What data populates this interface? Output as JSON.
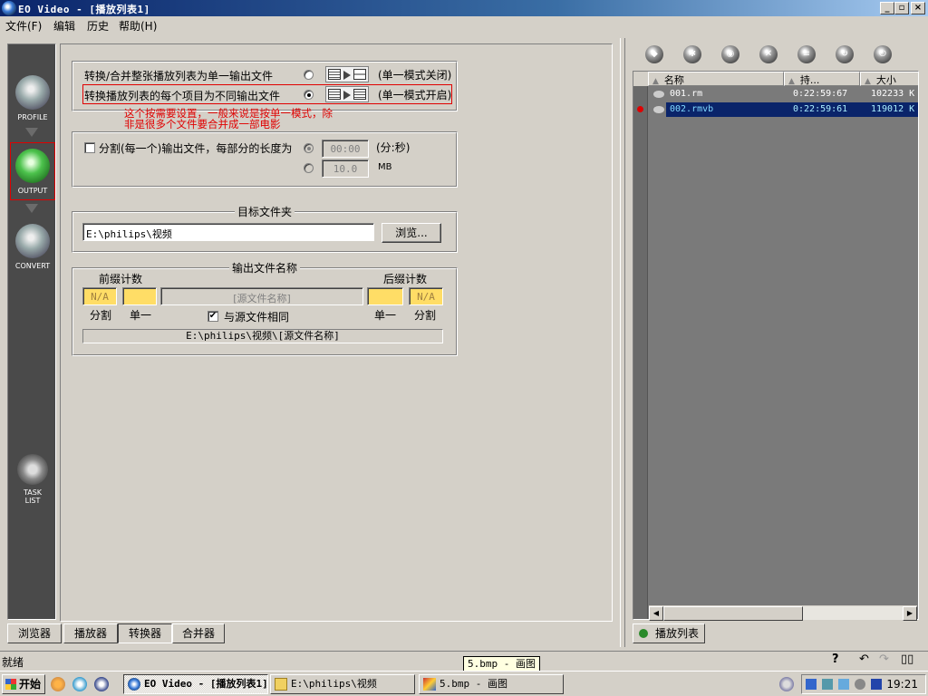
{
  "window": {
    "title": "EO Video - [播放列表1]",
    "min": "_",
    "max": "▫",
    "close": "×"
  },
  "menu": [
    "文件(F)",
    "编辑",
    "历史",
    "帮助(H)"
  ],
  "nav": {
    "profile": "PROFILE",
    "output": "OUTPUT",
    "convert": "CONVERT",
    "task_list": "TASK LIST"
  },
  "mode": {
    "single_label": "转换/合并整张播放列表为单一输出文件",
    "single_mode": "(单一模式关闭)",
    "multi_label": "转换播放列表的每个项目为不同输出文件",
    "multi_mode": "(单一模式开启)",
    "selected": "multi"
  },
  "note": {
    "line1": "这个按需要设置，一般来说是按单一模式，除",
    "line2": "非是很多个文件要合并成一部电影"
  },
  "split": {
    "label": "分割(每一个)输出文件，每部分的长度为",
    "checked": false,
    "time_value": "00:00",
    "time_unit": "(分:秒)",
    "size_value": "10.0",
    "size_unit": "MB"
  },
  "target": {
    "legend": "目标文件夹",
    "path": "E:\\philips\\视频",
    "browse": "浏览..."
  },
  "outname": {
    "legend": "输出文件名称",
    "prefix_label": "前缀计数",
    "suffix_label": "后缀计数",
    "na1": "N/A",
    "na2": "N/A",
    "source_name": "[源文件名称]",
    "split": "分割",
    "single": "单一",
    "single2": "单一",
    "split2": "分割",
    "same_as_source": "与源文件相同",
    "same_checked": true,
    "preview": "E:\\philips\\视频\\[源文件名称]"
  },
  "tabs": [
    "浏览器",
    "播放器",
    "转换器",
    "合并器"
  ],
  "playlist": {
    "columns": [
      "名称",
      "持...",
      "大小"
    ],
    "rows": [
      {
        "name": "001.rm",
        "duration": "0:22:59:67",
        "size": "102233 K"
      },
      {
        "name": "002.rmvb",
        "duration": "0:22:59:61",
        "size": "119012 K"
      }
    ],
    "selected_row": 1,
    "tab": "播放列表"
  },
  "status": {
    "text": "就绪",
    "tooltip": "5.bmp - 画图",
    "help": "?"
  },
  "taskbar": {
    "start": "开始",
    "items": [
      "EO Video - [播放列表1]",
      "E:\\philips\\视频",
      "5.bmp - 画图"
    ],
    "clock": "19:21"
  },
  "colors": {
    "accent": "#0a246a",
    "annotation": "#e00000",
    "output_green": "#3aa53a"
  }
}
